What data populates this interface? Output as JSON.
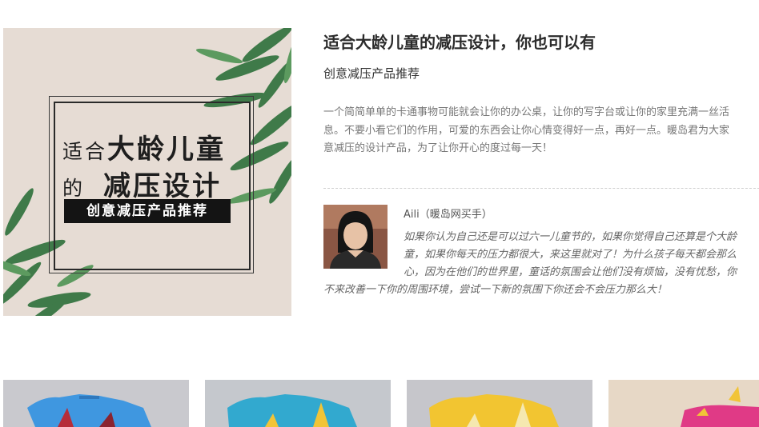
{
  "hero": {
    "line1_small": "适合",
    "line1_big": "大龄儿童",
    "line2_small": "的",
    "line2_big": "减压设计",
    "tag": "创意减压产品推荐"
  },
  "article": {
    "title": "适合大龄儿童的减压设计，你也可以有",
    "subtitle": "创意减压产品推荐",
    "desc_lines": [
      "一个简简单单的卡通事物可能就会让你的办公桌，让你的写字台或让你的家里充满一丝活",
      "息。不要小看它们的作用，可爱的东西会让你心情变得好一点，再好一点。暖岛君为大家",
      "意减压的设计产品，为了让你开心的度过每一天！"
    ]
  },
  "author": {
    "name": "Aili（暖岛网买手）",
    "quote_lines": [
      "如果你认为自己还是可以过六一儿童节的，如果你觉得自己还算是个大龄",
      "童，如果你每天的压力都很大，来这里就对了！为什么孩子每天都会那么",
      "心，因为在他们的世界里，童话的氛围会让他们没有烦恼，没有忧愁，你",
      "不来改善一下你的周围环境，尝试一下新的氛围下你还会不会压力那么大！"
    ]
  },
  "products": [
    {
      "name": "blue-toy",
      "color": "#3f97e0"
    },
    {
      "name": "cyan-toy",
      "color": "#32a9cf"
    },
    {
      "name": "yellow-toy",
      "color": "#f2c531"
    },
    {
      "name": "pink-toy",
      "color": "#e03a86"
    }
  ]
}
